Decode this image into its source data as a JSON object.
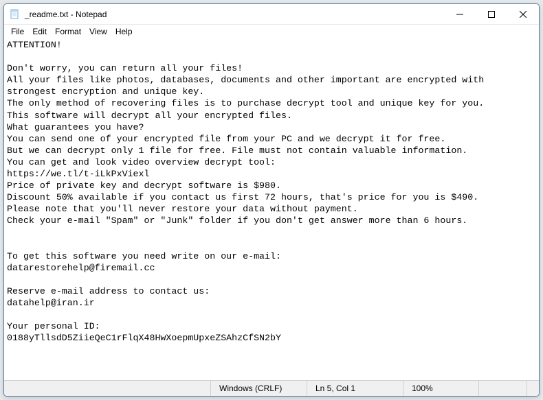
{
  "titlebar": {
    "title": "_readme.txt - Notepad"
  },
  "menubar": {
    "file": "File",
    "edit": "Edit",
    "format": "Format",
    "view": "View",
    "help": "Help"
  },
  "content": "ATTENTION!\n\nDon't worry, you can return all your files!\nAll your files like photos, databases, documents and other important are encrypted with strongest encryption and unique key.\nThe only method of recovering files is to purchase decrypt tool and unique key for you.\nThis software will decrypt all your encrypted files.\nWhat guarantees you have?\nYou can send one of your encrypted file from your PC and we decrypt it for free.\nBut we can decrypt only 1 file for free. File must not contain valuable information.\nYou can get and look video overview decrypt tool:\nhttps://we.tl/t-iLkPxViexl\nPrice of private key and decrypt software is $980.\nDiscount 50% available if you contact us first 72 hours, that's price for you is $490.\nPlease note that you'll never restore your data without payment.\nCheck your e-mail \"Spam\" or \"Junk\" folder if you don't get answer more than 6 hours.\n\n\nTo get this software you need write on our e-mail:\ndatarestorehelp@firemail.cc\n\nReserve e-mail address to contact us:\ndatahelp@iran.ir\n\nYour personal ID:\n0188yTllsdD5ZiieQeC1rFlqX48HwXoepmUpxeZSAhzCfSN2bY",
  "statusbar": {
    "encoding": "Windows (CRLF)",
    "position": "Ln 5, Col 1",
    "zoom": "100%"
  }
}
